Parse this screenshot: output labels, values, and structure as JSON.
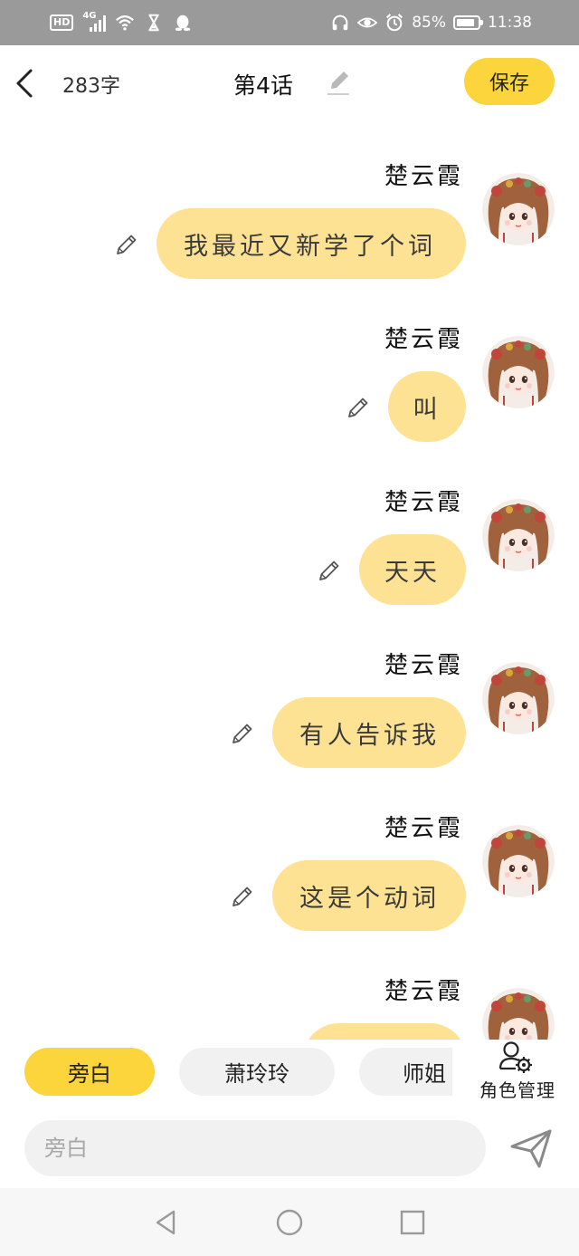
{
  "status_bar": {
    "hd": "HD",
    "network": "4G",
    "battery_text": "85%",
    "battery_level": 0.85,
    "time": "11:38",
    "icons": [
      "signal-icon",
      "wifi-icon",
      "hourglass-icon",
      "qq-penguin-icon",
      "headphones-icon",
      "eye-icon",
      "alarm-icon",
      "battery-icon"
    ]
  },
  "header": {
    "word_count": "283字",
    "title": "第4话",
    "save_label": "保存",
    "icons": [
      "back-arrow-icon",
      "pencil-icon"
    ]
  },
  "messages": [
    {
      "speaker": "楚云霞",
      "text": "我最近又新学了个词"
    },
    {
      "speaker": "楚云霞",
      "text": "叫"
    },
    {
      "speaker": "楚云霞",
      "text": "天天"
    },
    {
      "speaker": "楚云霞",
      "text": "有人告诉我"
    },
    {
      "speaker": "楚云霞",
      "text": "这是个动词"
    },
    {
      "speaker": "楚云霞",
      "text": ""
    }
  ],
  "roles": {
    "items": [
      {
        "label": "旁白",
        "active": true
      },
      {
        "label": "萧玲玲",
        "active": false
      },
      {
        "label": "师姐",
        "active": false
      }
    ],
    "manage_label": "角色管理"
  },
  "composer": {
    "placeholder": "旁白"
  },
  "colors": {
    "accent": "#fcd43b",
    "bubble": "#fee294",
    "chip": "#f1f1f1",
    "status_bar": "#9a9a9a"
  },
  "nav_icons": [
    "nav-back-icon",
    "nav-home-icon",
    "nav-recents-icon"
  ]
}
